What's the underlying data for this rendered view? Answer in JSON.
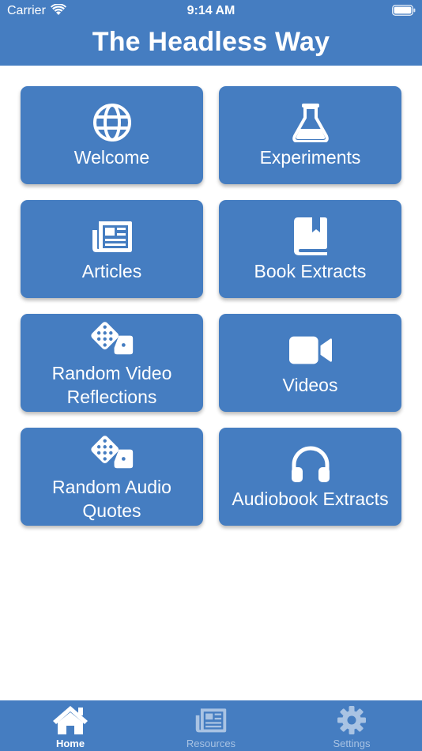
{
  "status_bar": {
    "carrier": "Carrier",
    "time": "9:14 AM"
  },
  "header": {
    "title": "The Headless Way"
  },
  "tiles": [
    {
      "label": "Welcome",
      "icon": "globe-icon"
    },
    {
      "label": "Experiments",
      "icon": "flask-icon"
    },
    {
      "label": "Articles",
      "icon": "newspaper-icon"
    },
    {
      "label": "Book Extracts",
      "icon": "book-icon"
    },
    {
      "label": "Random Video\nReflections",
      "icon": "dice-icon"
    },
    {
      "label": "Videos",
      "icon": "video-camera-icon"
    },
    {
      "label": "Random Audio\nQuotes",
      "icon": "dice-icon"
    },
    {
      "label": "Audiobook Extracts",
      "icon": "headphones-icon"
    }
  ],
  "tabbar": {
    "tabs": [
      {
        "label": "Home",
        "icon": "home-icon",
        "active": true
      },
      {
        "label": "Resources",
        "icon": "newspaper-icon",
        "active": false
      },
      {
        "label": "Settings",
        "icon": "gear-icon",
        "active": false
      }
    ]
  },
  "colors": {
    "brand": "#457DC1",
    "inactive_tab": "#A9C3E3",
    "text": "#FFFFFF"
  }
}
